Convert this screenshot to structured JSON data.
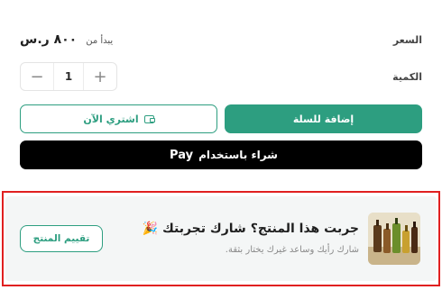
{
  "price": {
    "label": "السعر",
    "value": "٨٠٠ ر.س",
    "prefix": "يبدأ من"
  },
  "quantity": {
    "label": "الكمية",
    "value": "1",
    "minus": "−",
    "plus": "+"
  },
  "actions": {
    "add_to_cart": "إضافة للسلة",
    "buy_now": "اشتري الآن",
    "apple_pay_text": "شراء باستخدام",
    "apple_pay_brand": "Pay",
    "apple_logo": ""
  },
  "review_prompt": {
    "title": "جربت هذا المنتج؟ شارك تجربتك",
    "emoji": "🎉",
    "subtitle": "شارك رأيك وساعد غيرك يختار بثقة.",
    "button": "تقييم المنتج"
  },
  "colors": {
    "accent": "#2d9e80",
    "highlight_border": "#e02020",
    "apple_pay_bg": "#000000"
  },
  "icons": {
    "wallet": "wallet-icon",
    "apple": "apple-icon",
    "minus": "minus-icon",
    "plus": "plus-icon",
    "thumbnail": "product-thumbnail"
  }
}
